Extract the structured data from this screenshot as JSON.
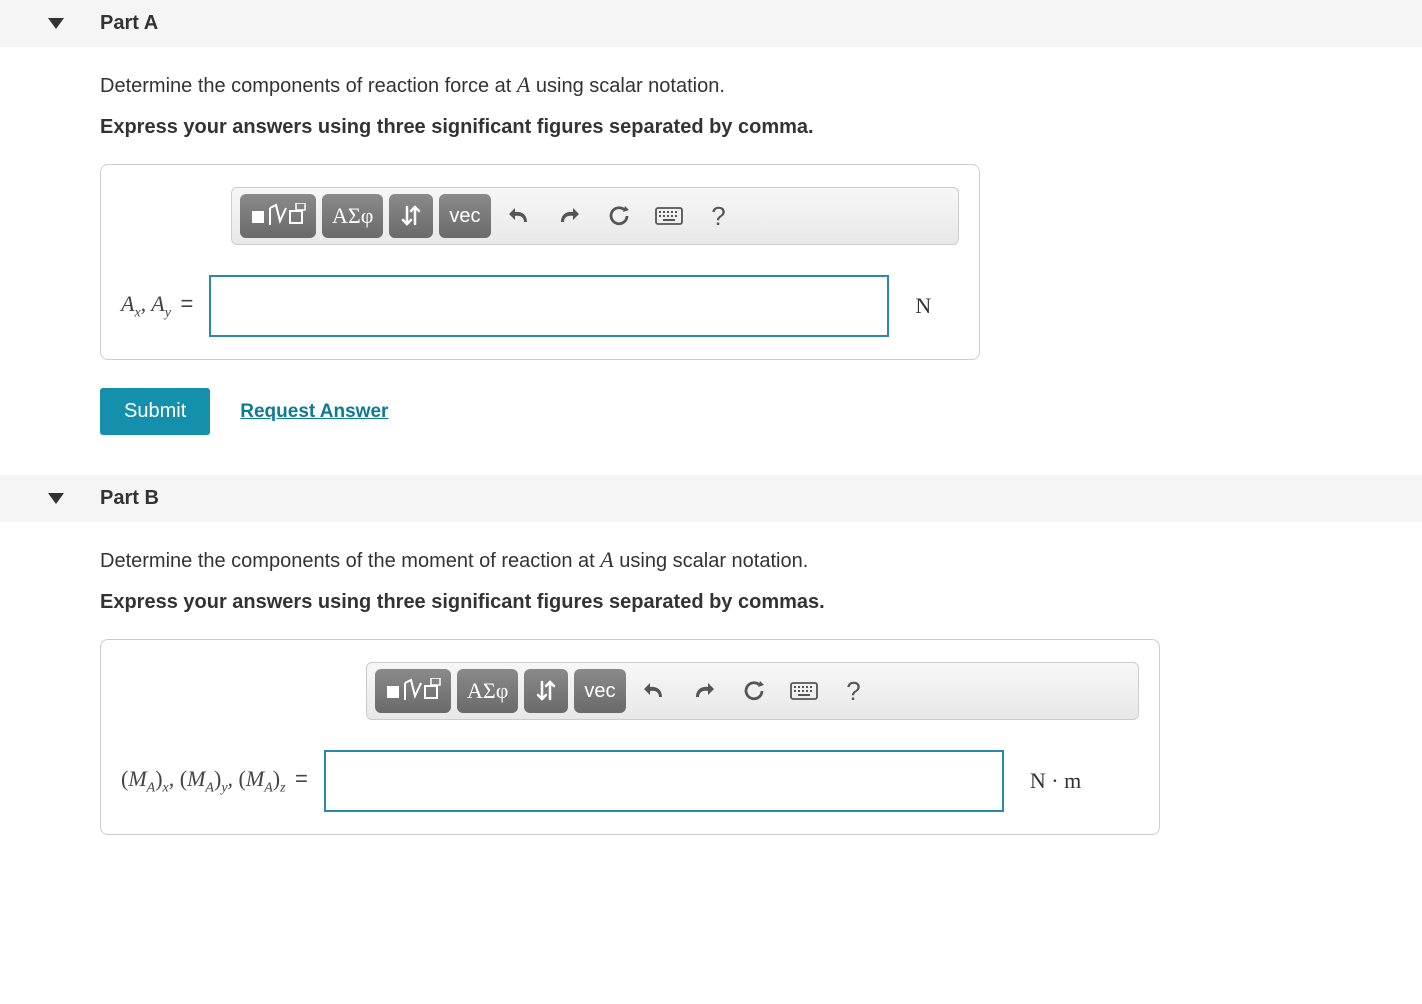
{
  "parts": [
    {
      "id": "A",
      "title": "Part A",
      "question_pre": "Determine the components of reaction force at ",
      "question_var": "A",
      "question_post": " using scalar notation.",
      "instruction": "Express your answers using three significant figures separated by comma.",
      "toolbar": {
        "templates": "math-templates",
        "greek": "ΑΣφ",
        "sort": "↓↑",
        "vec": "vec",
        "undo": "undo",
        "redo": "redo",
        "reset": "reset",
        "keyboard": "keyboard",
        "help": "?"
      },
      "var_label_html": "A<sub>x</sub>, A<sub>y</sub>",
      "unit": "N",
      "submit": "Submit",
      "request": "Request Answer"
    },
    {
      "id": "B",
      "title": "Part B",
      "question_pre": "Determine the components of the moment of reaction at ",
      "question_var": "A",
      "question_post": " using scalar notation.",
      "instruction": "Express your answers using three significant figures separated by commas.",
      "toolbar": {
        "templates": "math-templates",
        "greek": "ΑΣφ",
        "sort": "↓↑",
        "vec": "vec",
        "undo": "undo",
        "redo": "redo",
        "reset": "reset",
        "keyboard": "keyboard",
        "help": "?"
      },
      "var_label_html": "(M<sub>A</sub>)<sub>x</sub>, (M<sub>A</sub>)<sub>y</sub>, (M<sub>A</sub>)<sub>z</sub>",
      "unit": "N · m"
    }
  ],
  "var_labels": {
    "a_pre": "A",
    "a_x": "x",
    "a_sep": ", ",
    "a_pre2": "A",
    "a_y": "y",
    "b_o1": "(",
    "b_M1": "M",
    "b_A1": "A",
    "b_c1": ")",
    "b_x": "x",
    "b_s1": ", ",
    "b_o2": "(",
    "b_M2": "M",
    "b_A2": "A",
    "b_c2": ")",
    "b_y": "y",
    "b_s2": ", ",
    "b_o3": "(",
    "b_M3": "M",
    "b_A3": "A",
    "b_c3": ")",
    "b_z": "z"
  },
  "eq": "="
}
